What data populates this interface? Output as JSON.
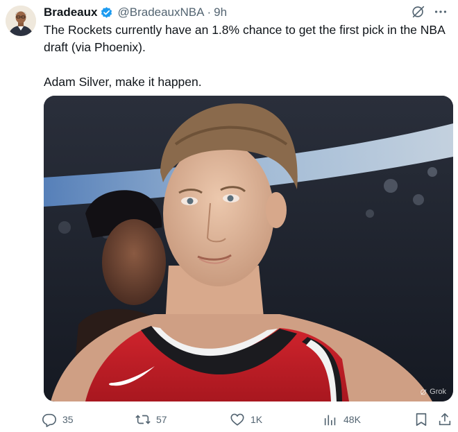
{
  "author": {
    "display_name": "Bradeaux",
    "handle": "@BradeauxNBA",
    "time": "9h",
    "verified": true,
    "avatar": "avatar"
  },
  "icons": {
    "grok": "grok-icon",
    "more": "more-icon"
  },
  "tweet": {
    "line1": "The Rockets currently have an 1.8% chance to get the first pick in the NBA draft (via Phoenix).",
    "line2": "Adam Silver, make it happen."
  },
  "media": {
    "watermark": "Grok"
  },
  "actions": {
    "replies": "35",
    "reposts": "57",
    "likes": "1K",
    "views": "48K"
  },
  "colors": {
    "accent": "#1d9bf0",
    "text": "#0f1419",
    "muted": "#536471",
    "jersey": "#c8202a"
  }
}
